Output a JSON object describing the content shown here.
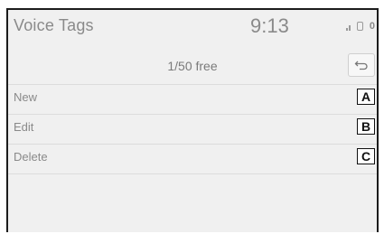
{
  "header": {
    "title": "Voice Tags",
    "clock": "9:13",
    "notification_count": "0"
  },
  "summary": {
    "free_text": "1/50 free"
  },
  "back": {
    "icon": "back-arrow-icon"
  },
  "menu": {
    "items": [
      {
        "label": "New",
        "callout": "A"
      },
      {
        "label": "Edit",
        "callout": "B"
      },
      {
        "label": "Delete",
        "callout": "C"
      }
    ]
  }
}
